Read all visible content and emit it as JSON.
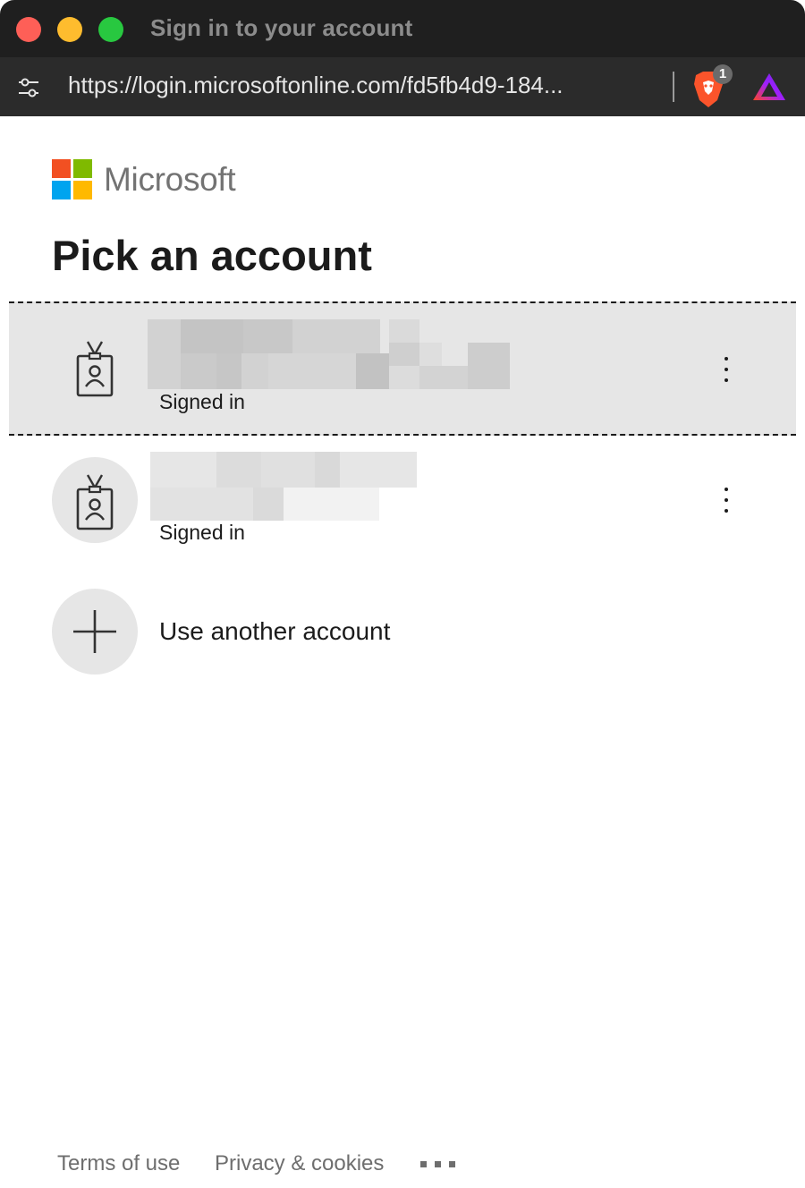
{
  "window": {
    "title": "Sign in to your account",
    "url": "https://login.microsoftonline.com/fd5fb4d9-184...",
    "brave_badge_count": "1"
  },
  "icons": {
    "controls": "tune-icon",
    "brave": "brave-shields-icon",
    "rewards": "brave-rewards-icon",
    "account": "badge-person-icon",
    "add": "plus-icon",
    "more": "vertical-ellipsis-icon"
  },
  "colors": {
    "ms_red": "#f25022",
    "ms_green": "#7fba00",
    "ms_blue": "#00a4ef",
    "ms_yellow": "#ffb900",
    "selected_row_bg": "#e6e6e6"
  },
  "brand": {
    "name": "Microsoft"
  },
  "page": {
    "title": "Pick an account"
  },
  "accounts": [
    {
      "status": "Signed in"
    },
    {
      "status": "Signed in"
    }
  ],
  "add_account": {
    "label": "Use another account"
  },
  "footer": {
    "terms": "Terms of use",
    "privacy": "Privacy & cookies"
  }
}
